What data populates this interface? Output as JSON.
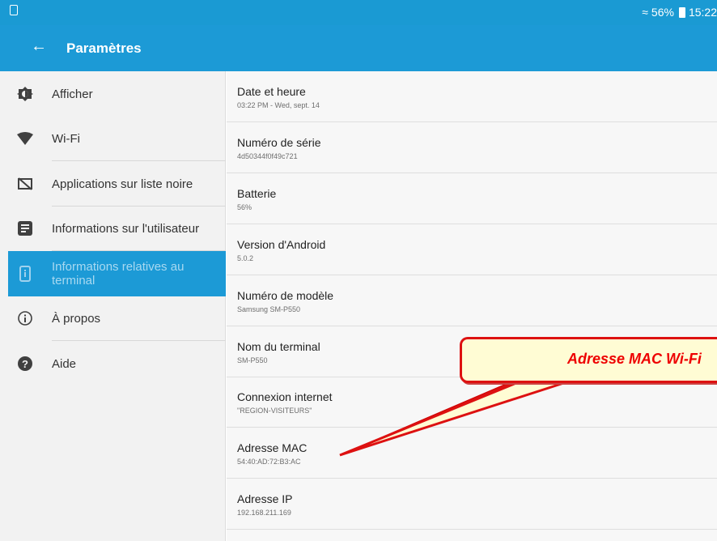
{
  "status_bar": {
    "notification_icon": "notification-icon",
    "wifi_icon": "wifi-icon",
    "battery": "56%",
    "time": "15:22"
  },
  "app_bar": {
    "back_icon": "back-arrow-icon",
    "title": "Paramètres"
  },
  "sidebar": {
    "items": [
      {
        "label": "Afficher",
        "icon": "brightness-icon"
      },
      {
        "label": "Wi-Fi",
        "icon": "wifi-icon"
      },
      {
        "label": "Applications sur liste noire",
        "icon": "blacklist-icon"
      },
      {
        "label": "Informations sur l'utilisateur",
        "icon": "user-info-icon"
      },
      {
        "label": "Informations relatives au terminal",
        "icon": "device-info-icon",
        "active": true
      },
      {
        "label": "À propos",
        "icon": "info-icon"
      },
      {
        "label": "Aide",
        "icon": "help-icon"
      }
    ]
  },
  "details": [
    {
      "title": "Date et heure",
      "value": "03:22 PM - Wed, sept. 14"
    },
    {
      "title": "Numéro de série",
      "value": "4d50344f0f49c721"
    },
    {
      "title": "Batterie",
      "value": "56%"
    },
    {
      "title": "Version d'Android",
      "value": "5.0.2"
    },
    {
      "title": "Numéro de modèle",
      "value": "Samsung SM-P550"
    },
    {
      "title": "Nom du terminal",
      "value": "SM-P550"
    },
    {
      "title": "Connexion internet",
      "value": "\"REGION-VISITEURS\""
    },
    {
      "title": "Adresse MAC",
      "value": "54:40:AD:72:B3:AC"
    },
    {
      "title": "Adresse IP",
      "value": "192.168.211.169"
    }
  ],
  "annotation": {
    "text": "Adresse MAC Wi-Fi",
    "color": "#e00000"
  }
}
